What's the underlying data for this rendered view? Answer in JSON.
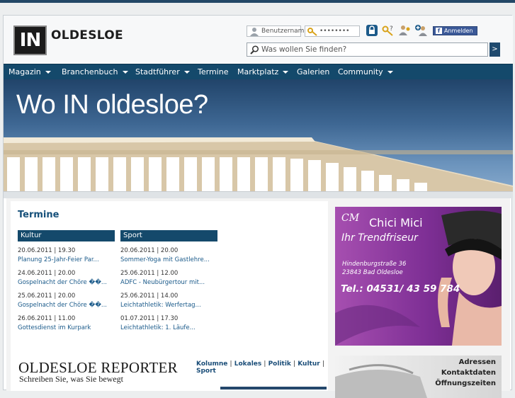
{
  "site": {
    "logo_in": "IN",
    "logo_name": "OLDESLOE"
  },
  "login": {
    "username_placeholder": "Benutzername",
    "password_mask": "••••••••",
    "facebook_label": "Anmelden",
    "facebook_glyph": "f",
    "icons": [
      "login-padlock-icon",
      "forgot-password-icon",
      "register-users-icon",
      "add-user-icon"
    ]
  },
  "search": {
    "placeholder": "Was wollen Sie finden?",
    "go_label": ">"
  },
  "nav": {
    "items": [
      {
        "label": "Magazin",
        "dropdown": true
      },
      {
        "label": "Branchenbuch",
        "dropdown": true
      },
      {
        "label": "Stadtführer",
        "dropdown": true
      },
      {
        "label": "Termine",
        "dropdown": false
      },
      {
        "label": "Marktplatz",
        "dropdown": true
      },
      {
        "label": "Galerien",
        "dropdown": false
      },
      {
        "label": "Community",
        "dropdown": true
      }
    ]
  },
  "hero": {
    "title": "Wo IN oldesloe?"
  },
  "termine": {
    "heading": "Termine",
    "columns": [
      {
        "title": "Kultur",
        "events": [
          {
            "date": "20.06.2011 | 19.30",
            "title": "Planung 25-Jahr-Feier Par..."
          },
          {
            "date": "24.06.2011 | 20.00",
            "title": "Gospelnacht der Chöre ��..."
          },
          {
            "date": "25.06.2011 | 20.00",
            "title": "Gospelnacht der Chöre ��..."
          },
          {
            "date": "26.06.2011 | 11.00",
            "title": "Gottesdienst im Kurpark"
          }
        ]
      },
      {
        "title": "Sport",
        "events": [
          {
            "date": "20.06.2011 | 20.00",
            "title": "Sommer-Yoga mit Gastlehre..."
          },
          {
            "date": "25.06.2011 | 12.00",
            "title": "ADFC - Neubürgertour mit..."
          },
          {
            "date": "25.06.2011 | 14.00",
            "title": "Leichtathletik: Werfertag..."
          },
          {
            "date": "01.07.2011 | 17.30",
            "title": "Leichtathletik: 1. Läufe..."
          }
        ]
      }
    ]
  },
  "reporter": {
    "title": "OLDESLOE REPORTER",
    "subtitle": "Schreiben Sie, was Sie bewegt",
    "links": [
      "Kolumne",
      "Lokales",
      "Politik",
      "Kultur",
      "Sport"
    ],
    "separator": "|"
  },
  "ads": {
    "salon": {
      "script": "CM",
      "name": "Chici Mici",
      "tagline": "Ihr Trendfriseur",
      "street": "Hindenburgstraße 36",
      "city": "23843 Bad Oldesloe",
      "phone": "Tel.: 04531/ 43 59 784"
    },
    "directory": {
      "lines": [
        "Adressen",
        "Kontaktdaten",
        "Öffnungszeiten"
      ]
    }
  },
  "colors": {
    "brand": "#14496b",
    "accent": "#1a5a8a",
    "ad_purple": "#7e2f95",
    "facebook": "#3b5998"
  }
}
